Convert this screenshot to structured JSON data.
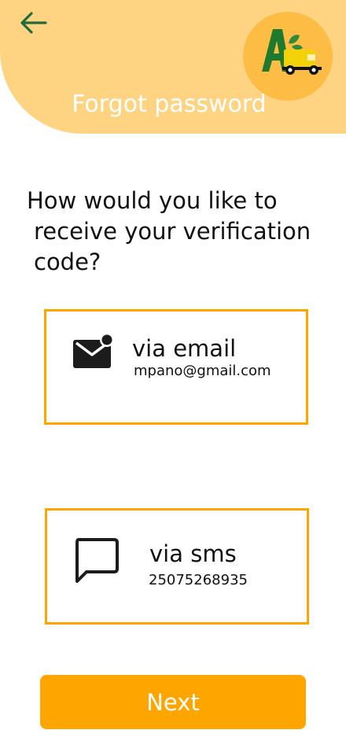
{
  "header": {
    "title": "Forgot password",
    "back_icon": "arrow-left-icon",
    "logo_icon": "brand-logo-icon"
  },
  "question": {
    "line1": "How would you like to",
    "line2": "receive your verification",
    "line3": "code?"
  },
  "options": {
    "email": {
      "title": "via email",
      "value": "mpano@gmail.com",
      "icon": "mail-notification-icon"
    },
    "sms": {
      "title": "via sms",
      "value": "25075268935",
      "icon": "message-icon"
    }
  },
  "actions": {
    "next_label": "Next"
  },
  "colors": {
    "header_bg": "#fed482",
    "logo_bg": "#fdbd44",
    "accent": "#ffa500",
    "back_arrow": "#1f6b3a"
  }
}
